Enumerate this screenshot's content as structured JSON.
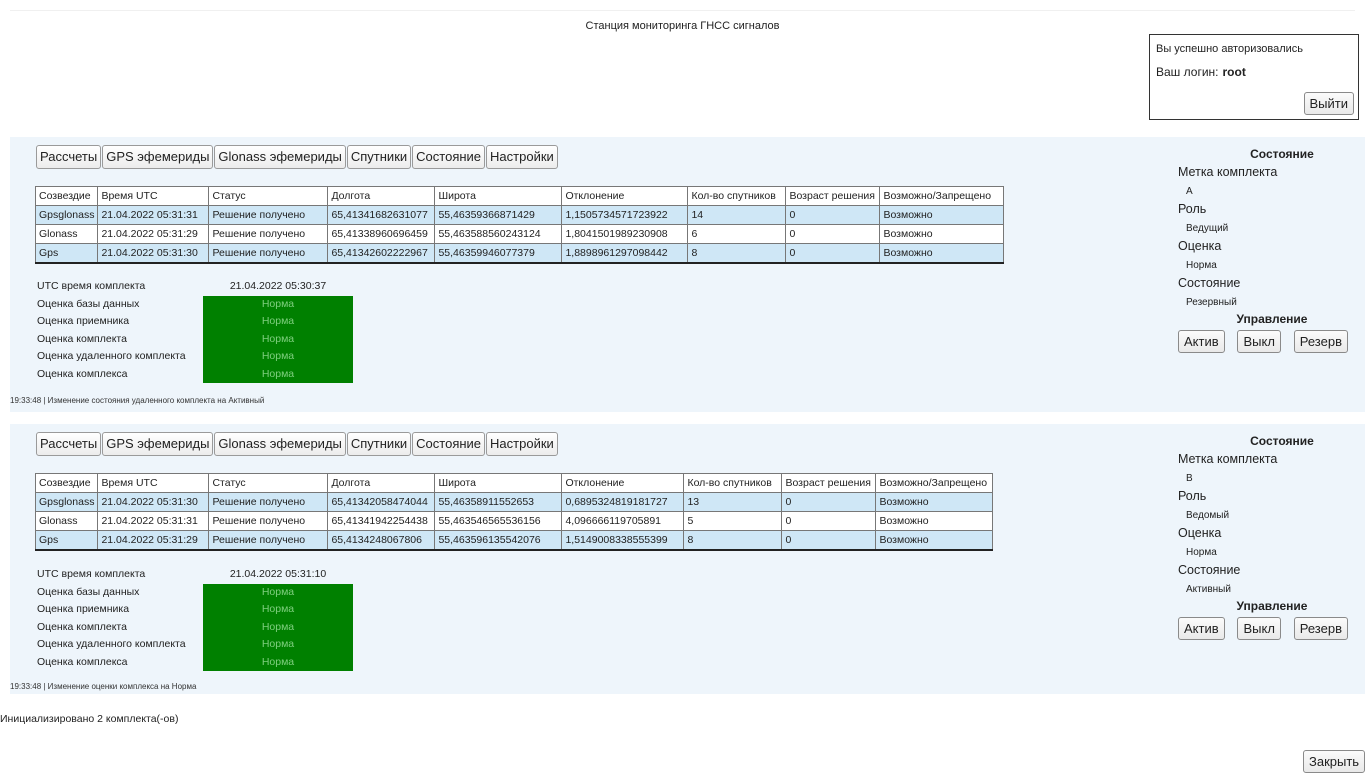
{
  "page": {
    "title": "Станция мониторинга ГНСС сигналов"
  },
  "auth": {
    "message": "Вы успешно авторизовались",
    "login_label": "Ваш логин:",
    "login_value": "root",
    "logout_label": "Выйти"
  },
  "tabs": [
    "Рассчеты",
    "GPS эфемериды",
    "Glonass эфемериды",
    "Спутники",
    "Состояние",
    "Настройки"
  ],
  "columns": [
    "Созвездие",
    "Время UTC",
    "Статус",
    "Долгота",
    "Широта",
    "Отклонение",
    "Кол-во спутников",
    "Возраст решения",
    "Возможно/Запрещено"
  ],
  "status_labels": [
    "UTC время комплекта",
    "Оценка базы данных",
    "Оценка приемника",
    "Оценка комплекта",
    "Оценка удаленного комплекта",
    "Оценка комплекса"
  ],
  "side_labels": {
    "title": "Состояние",
    "mark": "Метка комплекта",
    "role": "Роль",
    "rating": "Оценка",
    "state": "Состояние",
    "control": "Управление",
    "btn_active": "Актив",
    "btn_off": "Выкл",
    "btn_reserve": "Резерв"
  },
  "panels": [
    {
      "rows": [
        [
          "Gpsglonass",
          "21.04.2022 05:31:31",
          "Решение получено",
          "65,41341682631077",
          "55,46359366871429",
          "1,1505734571723922",
          "14",
          "0",
          "Возможно"
        ],
        [
          "Glonass",
          "21.04.2022 05:31:29",
          "Решение получено",
          "65,41338960696459",
          "55,463588560243124",
          "1,8041501989230908",
          "6",
          "0",
          "Возможно"
        ],
        [
          "Gps",
          "21.04.2022 05:31:30",
          "Решение получено",
          "65,41342602222967",
          "55,46359946077379",
          "1,8898961297098442",
          "8",
          "0",
          "Возможно"
        ]
      ],
      "utc_time": "21.04.2022 05:30:37",
      "ratings": [
        "Норма",
        "Норма",
        "Норма",
        "Норма",
        "Норма"
      ],
      "log": "19:33:48 | Изменение состояния удаленного комплекта на Активный",
      "side": {
        "mark": "A",
        "role": "Ведущий",
        "rating": "Норма",
        "state": "Резервный"
      }
    },
    {
      "rows": [
        [
          "Gpsglonass",
          "21.04.2022 05:31:30",
          "Решение получено",
          "65,41342058474044",
          "55,46358911552653",
          "0,6895324819181727",
          "13",
          "0",
          "Возможно"
        ],
        [
          "Glonass",
          "21.04.2022 05:31:31",
          "Решение получено",
          "65,41341942254438",
          "55,463546565536156",
          "4,096666119705891",
          "5",
          "0",
          "Возможно"
        ],
        [
          "Gps",
          "21.04.2022 05:31:29",
          "Решение получено",
          "65,4134248067806",
          "55,463596135542076",
          "1,5149008338555399",
          "8",
          "0",
          "Возможно"
        ]
      ],
      "utc_time": "21.04.2022 05:31:10",
      "ratings": [
        "Норма",
        "Норма",
        "Норма",
        "Норма",
        "Норма"
      ],
      "log": "19:33:48 | Изменение оценки комплекса на Норма",
      "side": {
        "mark": "B",
        "role": "Ведомый",
        "rating": "Норма",
        "state": "Активный"
      }
    }
  ],
  "footer": {
    "init_text": "Инициализировано 2 комплекта(-ов)",
    "close_label": "Закрыть"
  },
  "colors": {
    "panel_bg": "#eef5fb",
    "row_highlight": "#cfe7f6",
    "status_ok": "#008000"
  },
  "icons": {
    "edge": "collapse-arrow-icon"
  }
}
